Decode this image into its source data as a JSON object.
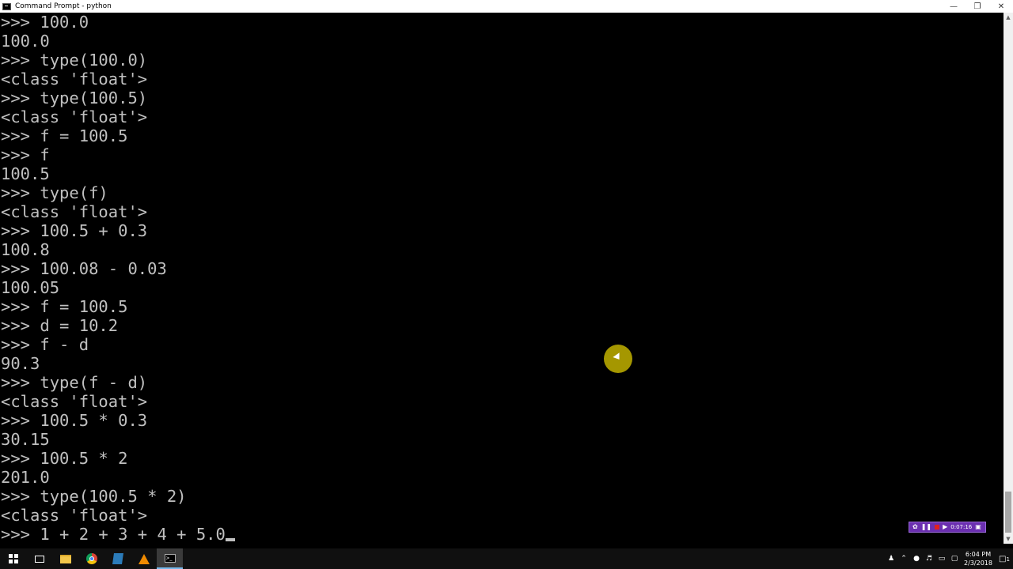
{
  "window": {
    "title": "Command Prompt - python",
    "minimize_glyph": "—",
    "restore_glyph": "❐",
    "close_glyph": "✕"
  },
  "console": {
    "lines": [
      ">>> 100.0",
      "100.0",
      ">>> type(100.0)",
      "<class 'float'>",
      ">>> type(100.5)",
      "<class 'float'>",
      ">>> f = 100.5",
      ">>> f",
      "100.5",
      ">>> type(f)",
      "<class 'float'>",
      ">>> 100.5 + 0.3",
      "100.8",
      ">>> 100.08 - 0.03",
      "100.05",
      ">>> f = 100.5",
      ">>> d = 10.2",
      ">>> f - d",
      "90.3",
      ">>> type(f - d)",
      "<class 'float'>",
      ">>> 100.5 * 0.3",
      "30.15",
      ">>> 100.5 * 2",
      "201.0",
      ">>> type(100.5 * 2)",
      "<class 'float'>"
    ],
    "current_input": ">>> 1 + 2 + 3 + 4 + 5.0",
    "text_color": "#c0c0c0",
    "background": "#000000"
  },
  "recorder": {
    "time": "0:07:16"
  },
  "taskbar": {
    "apps": [
      "start-button",
      "task-view",
      "file-explorer",
      "chrome",
      "app",
      "vlc",
      "command-prompt"
    ],
    "clock_time": "6:04 PM",
    "clock_date": "2/3/2018",
    "notification_count": "1"
  }
}
